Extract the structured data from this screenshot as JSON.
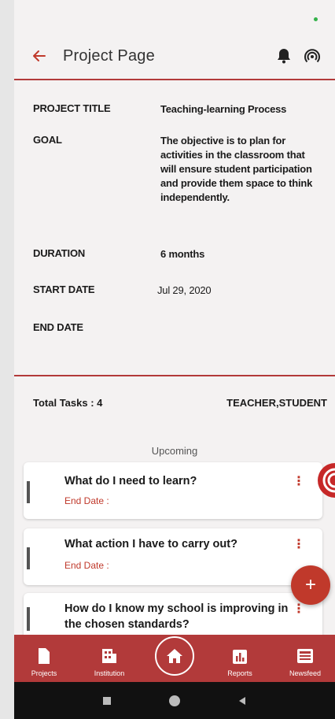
{
  "appbar": {
    "title": "Project Page"
  },
  "project": {
    "title_label": "PROJECT TITLE",
    "title_value": "Teaching-learning Process",
    "goal_label": "GOAL",
    "goal_value": "The objective is to plan for activities in the classroom that will ensure student participation and provide them space to think independently.",
    "duration_label": "DURATION",
    "duration_value": "6 months",
    "start_label": "START DATE",
    "start_value": "Jul 29, 2020",
    "end_label": "END DATE",
    "end_value": ""
  },
  "tasks": {
    "total": "Total Tasks : 4",
    "roles": "TEACHER,STUDENT",
    "section": "Upcoming",
    "items": [
      {
        "question": "What do I need to learn?",
        "end_date": "End Date :"
      },
      {
        "question": "What action I have to carry out?",
        "end_date": "End Date :"
      },
      {
        "question": "How do I know my school is improving in the chosen standards?",
        "end_date": ""
      }
    ]
  },
  "fab": {
    "icon": "+"
  },
  "bottomnav": {
    "projects": "Projects",
    "institution": "Institution",
    "reports": "Reports",
    "newsfeed": "Newsfeed"
  },
  "colors": {
    "accent": "#b23a3a",
    "danger": "#c0392b"
  }
}
